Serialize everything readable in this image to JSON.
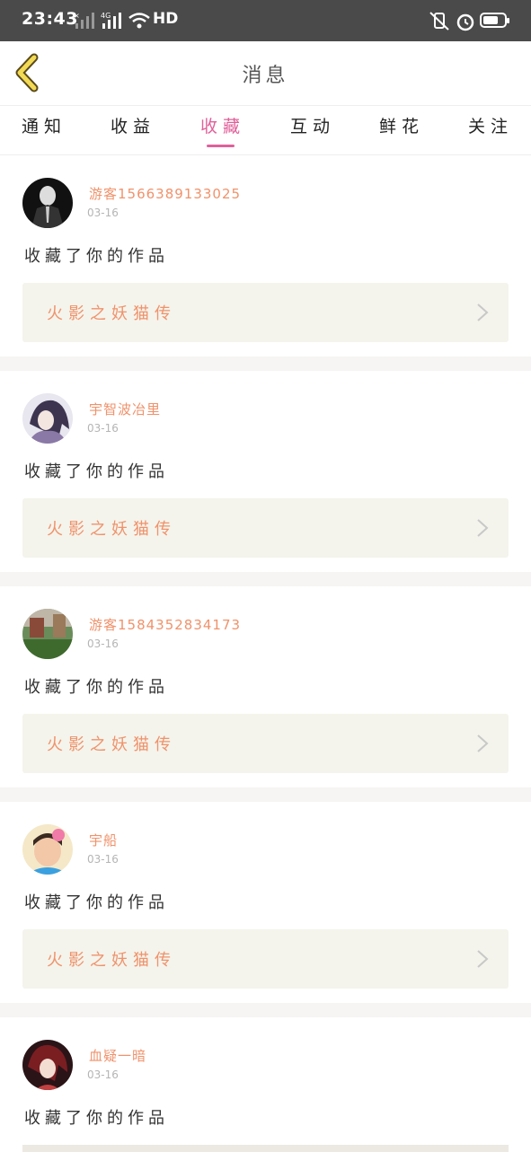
{
  "status_bar": {
    "time": "23:43",
    "network": "HD"
  },
  "header": {
    "title": "消息"
  },
  "tabs": [
    {
      "label": "通知"
    },
    {
      "label": "收益"
    },
    {
      "label": "收藏",
      "active": true
    },
    {
      "label": "互动"
    },
    {
      "label": "鲜花"
    },
    {
      "label": "关注"
    }
  ],
  "accent_color": "#e0609a",
  "name_color": "#f0926b",
  "messages": [
    {
      "user": "游客1566389133025",
      "date": "03-16",
      "action": "收藏了你的作品",
      "work": "火影之妖猫传"
    },
    {
      "user": "宇智波冶里",
      "date": "03-16",
      "action": "收藏了你的作品",
      "work": "火影之妖猫传"
    },
    {
      "user": "游客1584352834173",
      "date": "03-16",
      "action": "收藏了你的作品",
      "work": "火影之妖猫传"
    },
    {
      "user": "宇船",
      "date": "03-16",
      "action": "收藏了你的作品",
      "work": "火影之妖猫传"
    },
    {
      "user": "血疑一暗",
      "date": "03-16",
      "action": "收藏了你的作品",
      "work": ""
    }
  ]
}
